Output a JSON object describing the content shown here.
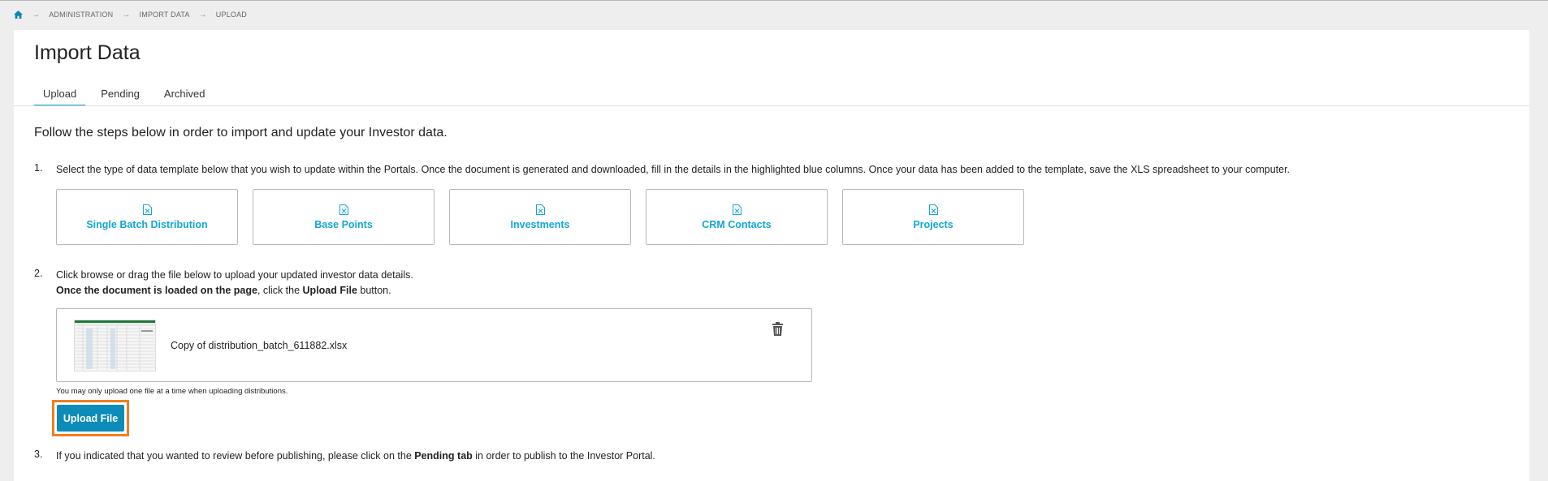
{
  "breadcrumb": {
    "items": [
      "ADMINISTRATION",
      "IMPORT DATA",
      "UPLOAD"
    ]
  },
  "page": {
    "title": "Import Data",
    "tabs": [
      {
        "label": "Upload",
        "active": true
      },
      {
        "label": "Pending",
        "active": false
      },
      {
        "label": "Archived",
        "active": false
      }
    ],
    "intro": "Follow the steps below in order to import and update your Investor data."
  },
  "steps": {
    "one": {
      "num": "1.",
      "text": "Select the type of data template below that you wish to update within the Portals. Once the document is generated and downloaded, fill in the details in the highlighted blue columns. Once your data has been added to the template, save the XLS spreadsheet to your computer."
    },
    "templates": [
      {
        "label": "Single Batch Distribution",
        "icon": "excel-file-icon"
      },
      {
        "label": "Base Points",
        "icon": "excel-file-icon"
      },
      {
        "label": "Investments",
        "icon": "excel-file-icon"
      },
      {
        "label": "CRM Contacts",
        "icon": "excel-file-icon"
      },
      {
        "label": "Projects",
        "icon": "excel-file-icon"
      }
    ],
    "two": {
      "num": "2.",
      "line1": "Click browse or drag the file below to upload your updated investor data details.",
      "line2_bold": "Once the document is loaded on the page",
      "line2_mid": ", click the ",
      "line2_bold2": "Upload File",
      "line2_end": " button."
    },
    "upload": {
      "file_name": "Copy of distribution_batch_611882.xlsx",
      "hint": "You may only upload one file at a time when uploading distributions.",
      "button_label": "Upload File"
    },
    "three": {
      "num": "3.",
      "pre": "If you indicated that you wanted to review before publishing, please click on the ",
      "bold": "Pending tab",
      "post": " in order to publish to the Investor Portal."
    }
  },
  "colors": {
    "accent": "#11a7d4",
    "button": "#0d8cb9",
    "highlight_border": "#f07e22"
  }
}
